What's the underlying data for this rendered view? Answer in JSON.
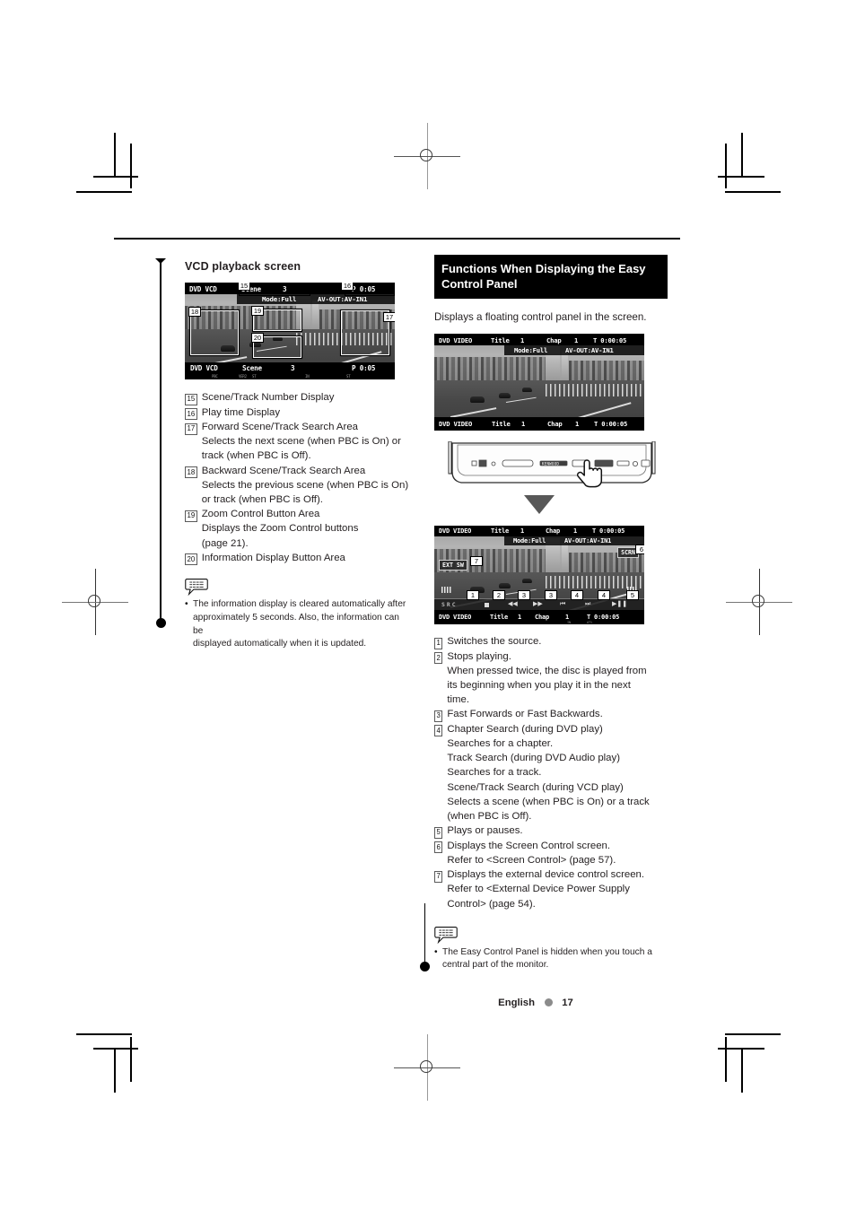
{
  "page": {
    "footer_language": "English",
    "footer_page_number": "17"
  },
  "left_column": {
    "heading": "VCD playback screen",
    "screen": {
      "top_bar": {
        "source": "DVD VCD",
        "field_label": "Scene",
        "field_value": "3",
        "time": "P 0:05"
      },
      "top_bar2": {
        "mode": "Mode:Full",
        "av": "AV-OUT:AV-IN1"
      },
      "bottom_bar": {
        "source": "DVD VCD",
        "field_label": "Scene",
        "field_value": "3",
        "time": "P 0:05"
      },
      "bottom_icons": [
        "PBC",
        "VER2",
        "ST",
        "IN",
        "ST"
      ],
      "callouts": [
        "15",
        "16",
        "17",
        "18",
        "19",
        "20"
      ]
    },
    "items": [
      {
        "num": "15",
        "title": "Scene/Track Number Display",
        "lines": []
      },
      {
        "num": "16",
        "title": "Play time Display",
        "lines": []
      },
      {
        "num": "17",
        "title": "Forward Scene/Track Search Area",
        "lines": [
          "Selects the next scene (when PBC is On) or",
          "track (when PBC is Off)."
        ]
      },
      {
        "num": "18",
        "title": "Backward Scene/Track Search Area",
        "lines": [
          "Selects the previous scene (when PBC is On)",
          "or track (when PBC is Off)."
        ]
      },
      {
        "num": "19",
        "title": "Zoom Control Button Area",
        "lines": [
          "Displays the Zoom Control buttons",
          "(page 21)."
        ]
      },
      {
        "num": "20",
        "title": "Information Display Button Area",
        "lines": []
      }
    ],
    "note": {
      "icon": "note-balloon-icon",
      "bullet": "•",
      "lines": [
        "The information display is cleared automatically after",
        "approximately 5 seconds. Also, the information can be",
        "displayed automatically when it is updated."
      ]
    }
  },
  "right_column": {
    "section_title_line1": "Functions When Displaying the Easy",
    "section_title_line2": "Control Panel",
    "intro": "Displays a floating control panel in the screen.",
    "screen_top": {
      "top_bar": {
        "source": "DVD VIDEO",
        "title_label": "Title",
        "title_value": "1",
        "chap_label": "Chap",
        "chap_value": "1",
        "time": "T 0:00:05"
      },
      "top_bar2": {
        "mode": "Mode:Full",
        "av": "AV-OUT:AV-IN1"
      },
      "bottom_bar": {
        "source": "DVD VIDEO",
        "title_label": "Title",
        "title_value": "1",
        "chap_label": "Chap",
        "chap_value": "1",
        "time": "T 0:00:05"
      }
    },
    "faceplate": {
      "alt": "head-unit-faceplate-illustration",
      "brand": "KENWOOD",
      "hand": "pointing-hand-icon",
      "arrow": "down-arrow-icon"
    },
    "screen_bottom": {
      "top_bar": {
        "source": "DVD VIDEO",
        "title_label": "Title",
        "title_value": "1",
        "chap_label": "Chap",
        "chap_value": "1",
        "time": "T 0:00:05"
      },
      "top_bar2": {
        "mode": "Mode:Full",
        "av": "AV-OUT:AV-IN1"
      },
      "bottom_bar": {
        "source": "DVD VIDEO",
        "title_label": "Title",
        "title_value": "1",
        "chap_label": "Chap",
        "chap_value": "1",
        "time": "T 0:00:05"
      },
      "scrn_button": "SCRN",
      "extsw_button": "EXT SW",
      "src_button": "SRC",
      "control_icons": [
        "stop",
        "rewind",
        "fast-forward",
        "previous-track",
        "next-track",
        "play-pause"
      ],
      "callouts": [
        "1",
        "2",
        "3",
        "3",
        "4",
        "4",
        "5",
        "6",
        "7"
      ]
    },
    "items": [
      {
        "num": "1",
        "title": "Switches the source.",
        "lines": []
      },
      {
        "num": "2",
        "title": "Stops playing.",
        "lines": [
          "When pressed twice, the disc is played from",
          "its beginning when you play it in the next",
          "time."
        ]
      },
      {
        "num": "3",
        "title": "Fast Forwards or Fast Backwards.",
        "lines": []
      },
      {
        "num": "4",
        "title": "Chapter Search (during DVD play)",
        "lines": [
          "Searches for a chapter.",
          "Track Search (during DVD Audio play)",
          "Searches for a track.",
          "Scene/Track Search (during VCD play)",
          "Selects a scene (when PBC is On) or a track",
          "(when PBC is Off)."
        ]
      },
      {
        "num": "5",
        "title": "Plays or pauses.",
        "lines": []
      },
      {
        "num": "6",
        "title": "Displays the Screen Control screen.",
        "lines": [
          "Refer to <Screen Control> (page 57)."
        ]
      },
      {
        "num": "7",
        "title": "Displays the external device control screen.",
        "lines": [
          "Refer to <External Device Power Supply",
          "Control> (page 54)."
        ]
      }
    ],
    "note": {
      "icon": "note-balloon-icon",
      "bullet": "•",
      "lines": [
        "The Easy Control Panel is hidden when you touch a",
        "central part of the monitor."
      ]
    }
  }
}
